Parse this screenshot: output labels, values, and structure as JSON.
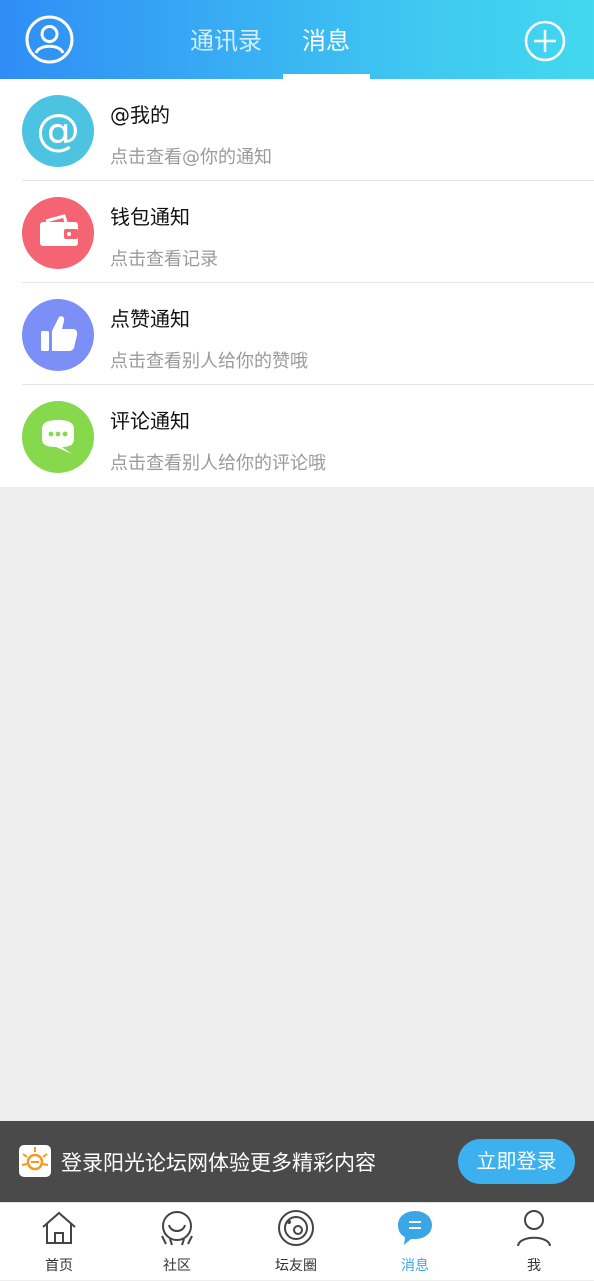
{
  "header": {
    "tabs": [
      {
        "label": "通讯录",
        "active": false
      },
      {
        "label": "消息",
        "active": true
      }
    ],
    "accent_gradient": [
      "#2f8df6",
      "#42d8ef"
    ],
    "left_icon": "user-circle-icon",
    "right_icon": "plus-circle-icon"
  },
  "messages": [
    {
      "title": "@我的",
      "subtitle": "点击查看@你的通知",
      "icon": "at-icon",
      "color": "#4cc3e0"
    },
    {
      "title": "钱包通知",
      "subtitle": "点击查看记录",
      "icon": "wallet-icon",
      "color": "#f46472"
    },
    {
      "title": "点赞通知",
      "subtitle": "点击查看别人给你的赞哦",
      "icon": "thumbs-up-icon",
      "color": "#7c8ff6"
    },
    {
      "title": "评论通知",
      "subtitle": "点击查看别人给你的评论哦",
      "icon": "comment-icon",
      "color": "#86d94c"
    }
  ],
  "banner": {
    "text": "登录阳光论坛网体验更多精彩内容",
    "button_label": "立即登录",
    "logo_icon": "sun-logo-icon"
  },
  "bottom_nav": [
    {
      "label": "首页",
      "icon": "home-icon",
      "active": false
    },
    {
      "label": "社区",
      "icon": "community-icon",
      "active": false
    },
    {
      "label": "坛友圈",
      "icon": "circle-icon",
      "active": false
    },
    {
      "label": "消息",
      "icon": "message-bubble-icon",
      "active": true
    },
    {
      "label": "我",
      "icon": "person-icon",
      "active": false
    }
  ]
}
